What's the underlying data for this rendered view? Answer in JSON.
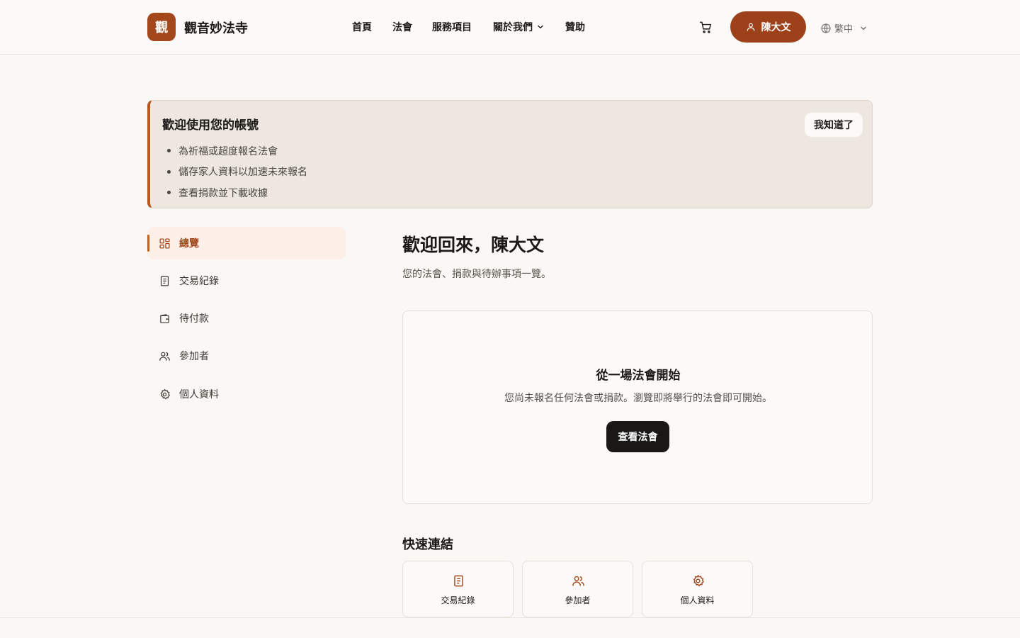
{
  "header": {
    "logo_char": "觀",
    "site_name": "觀音妙法寺",
    "nav": [
      {
        "label": "首頁"
      },
      {
        "label": "法會"
      },
      {
        "label": "服務項目"
      },
      {
        "label": "關於我們"
      },
      {
        "label": "贊助"
      }
    ],
    "user_name": "陳大文",
    "language": "繁中"
  },
  "banner": {
    "title": "歡迎使用您的帳號",
    "items": [
      "為祈福或超度報名法會",
      "儲存家人資料以加速未來報名",
      "查看捐款並下載收據"
    ],
    "dismiss_label": "我知道了"
  },
  "sidebar": {
    "items": [
      {
        "label": "總覽",
        "icon": "grid-icon"
      },
      {
        "label": "交易紀錄",
        "icon": "document-icon"
      },
      {
        "label": "待付款",
        "icon": "wallet-icon"
      },
      {
        "label": "參加者",
        "icon": "users-icon"
      },
      {
        "label": "個人資料",
        "icon": "gear-icon"
      }
    ]
  },
  "main": {
    "title": "歡迎回來，陳大文",
    "subtitle": "您的法會、捐款與待辦事項一覽。",
    "empty_state": {
      "title": "從一場法會開始",
      "text": "您尚未報名任何法會或捐款。瀏覽即將舉行的法會即可開始。",
      "button_label": "查看法會"
    },
    "quick_links": {
      "title": "快速連結",
      "items": [
        {
          "label": "交易紀錄",
          "icon": "document-icon"
        },
        {
          "label": "參加者",
          "icon": "users-icon"
        },
        {
          "label": "個人資料",
          "icon": "gear-icon"
        }
      ]
    }
  },
  "colors": {
    "accent": "#9c4119",
    "banner_bg": "#ede7e0",
    "page_bg": "#f9f8f5"
  }
}
